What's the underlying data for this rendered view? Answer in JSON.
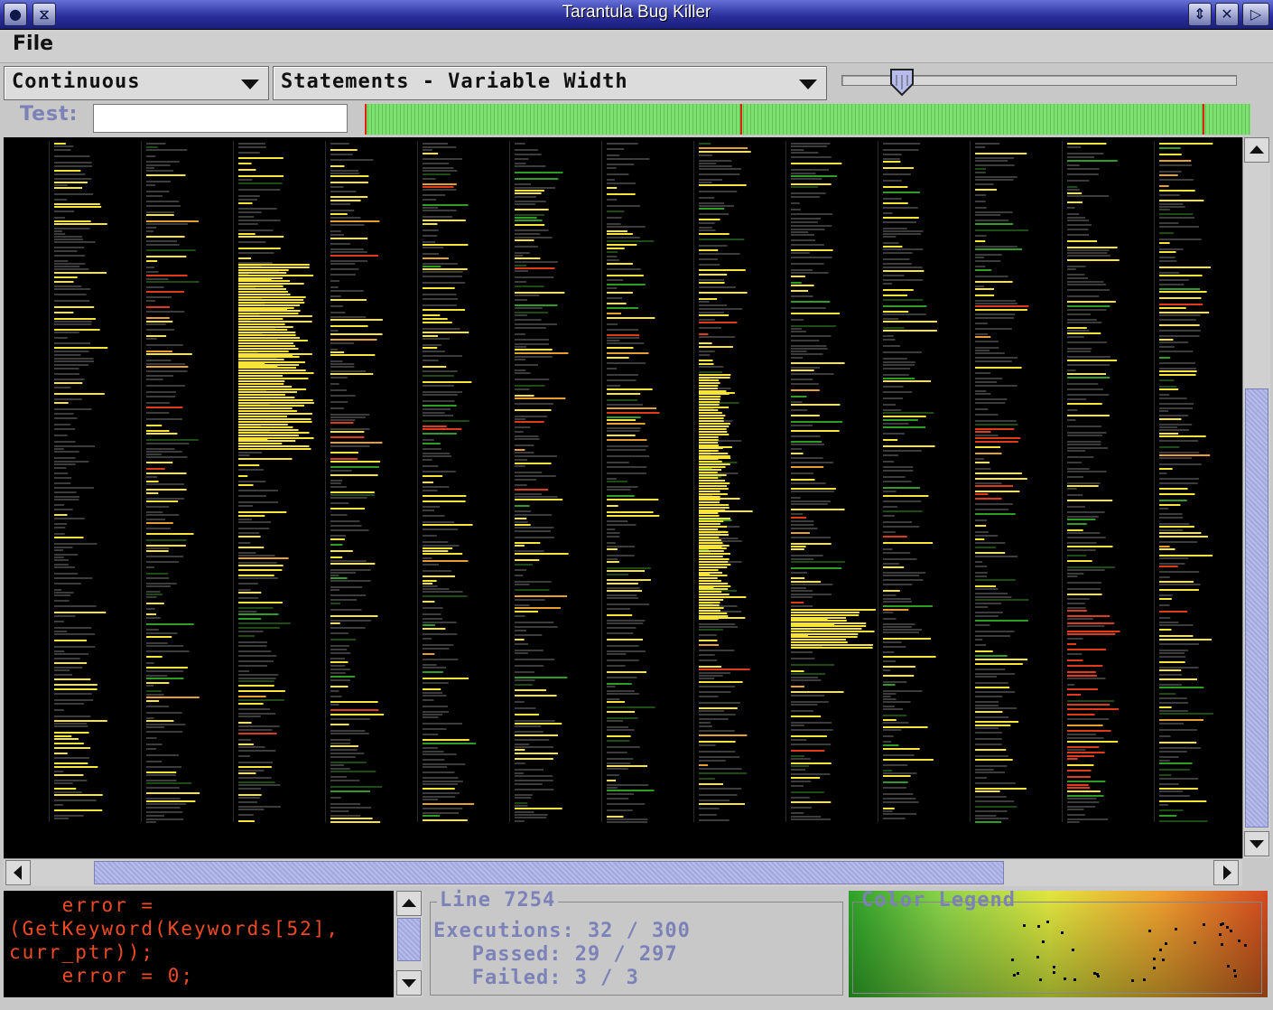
{
  "window": {
    "title": "Tarantula Bug Killer"
  },
  "menu": {
    "file": "File"
  },
  "toolbar": {
    "mode_value": "Continuous",
    "view_value": "Statements - Variable Width",
    "slider_level": 0.15
  },
  "test": {
    "label": "Test:",
    "value": ""
  },
  "code": {
    "lines": [
      "    error =",
      "(GetKeyword(Keywords[52],",
      "curr_ptr));",
      "    error = 0;"
    ]
  },
  "info": {
    "title": "Line 7254",
    "executions": "Executions: 32 / 300",
    "passed": "   Passed: 29 / 297",
    "failed": "   Failed: 3 / 3"
  },
  "legend": {
    "title": "Color Legend"
  },
  "colors": {
    "yellow": "#f8e438",
    "gray": "#3c3c3c",
    "red": "#e03a1c",
    "green": "#2e9c26",
    "orange": "#e6a030",
    "selection": "#b7bcec"
  },
  "icons": {
    "window_menu": "window-menu-icon",
    "minimize": "minimize-icon",
    "maximize": "maximize-icon",
    "close": "close-icon",
    "shade": "shade-icon",
    "dropdown": "chevron-down-icon"
  }
}
